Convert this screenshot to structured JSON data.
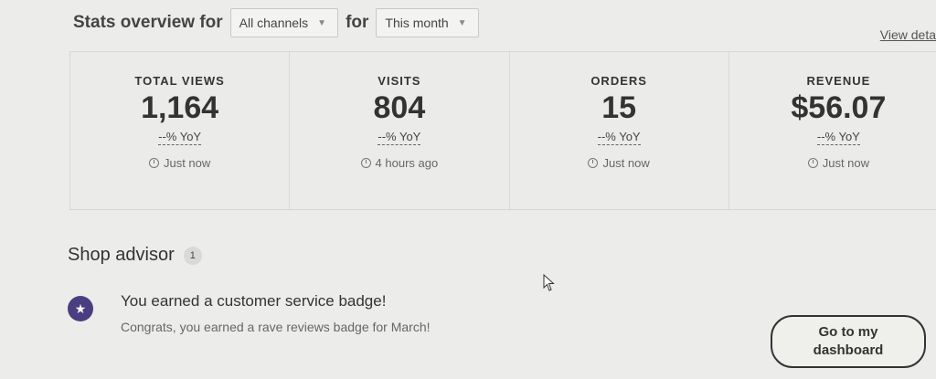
{
  "header": {
    "title": "Stats overview for",
    "channel_select": "All channels",
    "for_label": "for",
    "period_select": "This month",
    "view_details": "View deta"
  },
  "stats": [
    {
      "label": "TOTAL VIEWS",
      "value": "1,164",
      "yoy": "--% YoY",
      "updated": "Just now"
    },
    {
      "label": "VISITS",
      "value": "804",
      "yoy": "--% YoY",
      "updated": "4 hours ago"
    },
    {
      "label": "ORDERS",
      "value": "15",
      "yoy": "--% YoY",
      "updated": "Just now"
    },
    {
      "label": "REVENUE",
      "value": "$56.07",
      "yoy": "--% YoY",
      "updated": "Just now"
    }
  ],
  "advisor": {
    "title": "Shop advisor",
    "count": "1",
    "item_icon": "star-badge-icon",
    "item_title": "You earned a customer service badge!",
    "item_desc": "Congrats, you earned a rave reviews badge for March!",
    "button_label": "Go to my dashboard"
  },
  "colors": {
    "background": "#ecedeb",
    "badge_purple": "#4b3e80"
  }
}
